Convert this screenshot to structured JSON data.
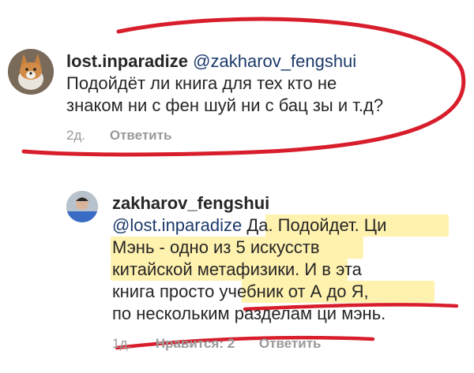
{
  "comments": [
    {
      "username": "lost.inparadize",
      "mention": "@zakharov_fengshui",
      "lines": [
        "Подойдёт ли книга для тех кто не",
        "знаком ни с фен шуй ни с бац зы и т.д?"
      ],
      "time": "2д.",
      "reply_label": "Ответить"
    },
    {
      "username": "zakharov_fengshui",
      "mention": "@lost.inparadize",
      "first_line_rest": " Да. Подойдет. Ци",
      "lines": [
        "Мэнь - одно из 5 искусств",
        "китайской метафизики. И в эта",
        "книга просто учебник от А до Я,",
        "по нескольким разделам ци мэнь."
      ],
      "time": "1д.",
      "likes_label": "Нравится: 2",
      "reply_label": "Ответить"
    }
  ],
  "colors": {
    "annotation_red": "#d81e2c",
    "highlight_yellow": "#ffe878",
    "meta_gray": "#999999",
    "mention_blue": "#1c3a6b"
  },
  "icons": [
    "corgi-dog-avatar",
    "user-photo-avatar"
  ]
}
